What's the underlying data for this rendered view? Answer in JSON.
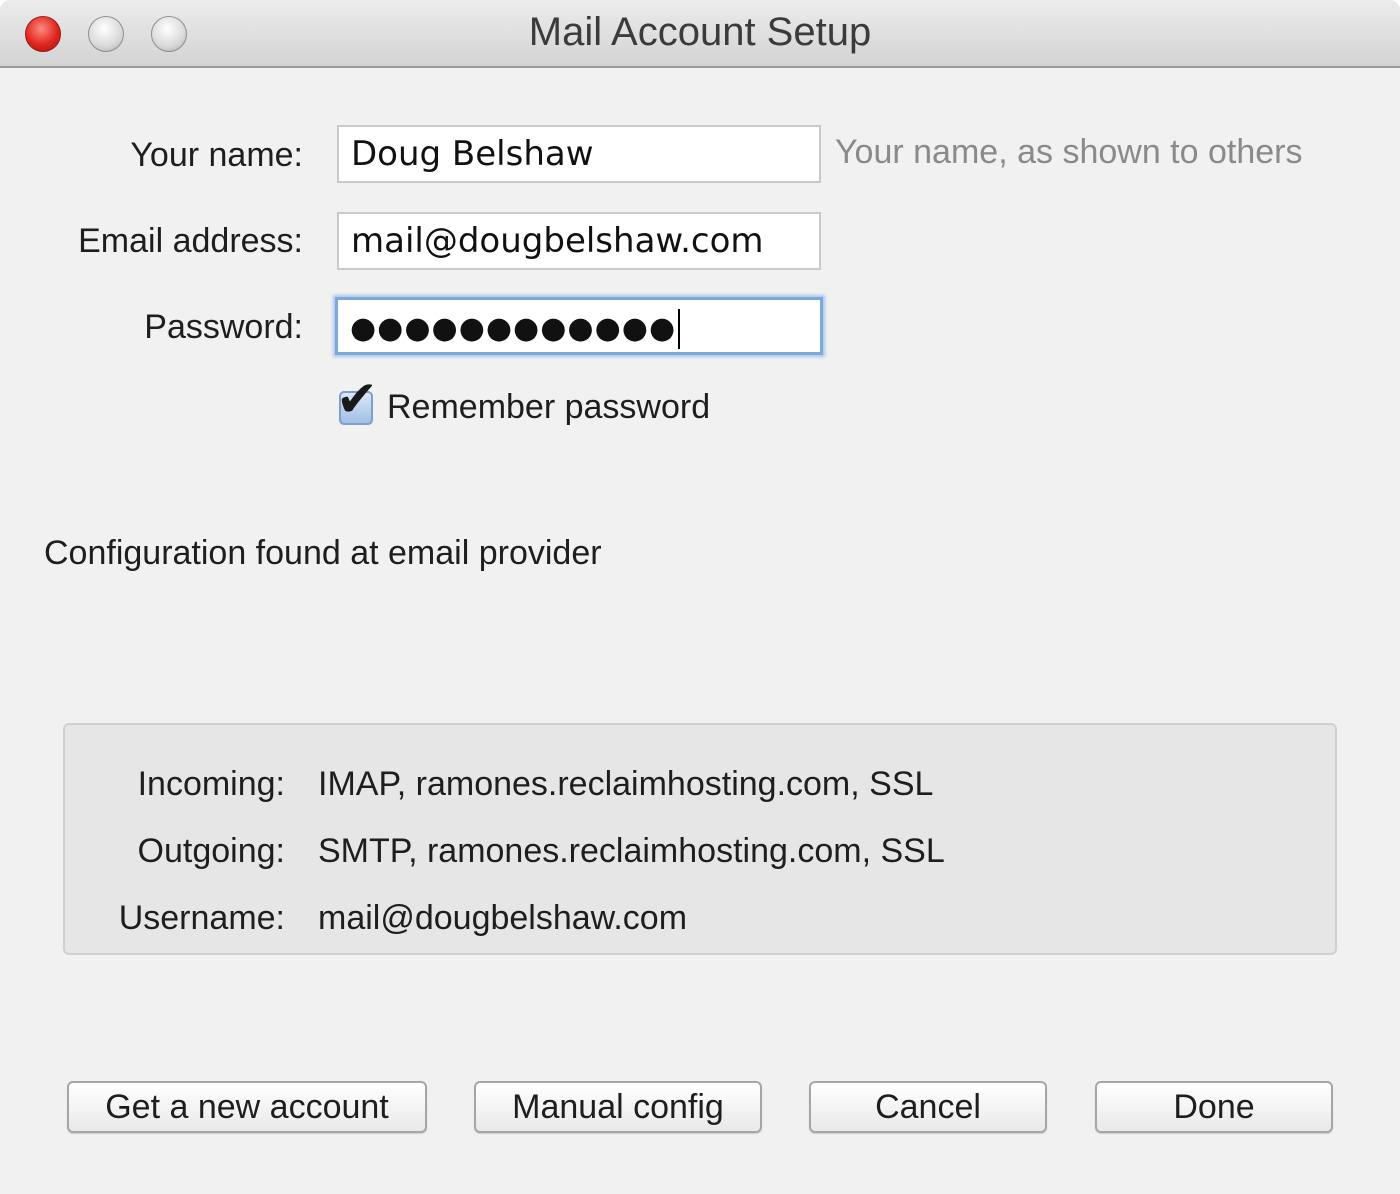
{
  "window": {
    "title": "Mail Account Setup"
  },
  "form": {
    "name_label": "Your name:",
    "name_value": "Doug Belshaw",
    "name_hint": "Your name, as shown to others",
    "email_label": "Email address:",
    "email_value": "mail@dougbelshaw.com",
    "password_label": "Password:",
    "password_value": "●●●●●●●●●●●●",
    "remember_label": "Remember password",
    "remember_checked": true
  },
  "status": {
    "message": "Configuration found at email provider"
  },
  "config": {
    "incoming_label": "Incoming:",
    "incoming_value": "IMAP, ramones.reclaimhosting.com, SSL",
    "outgoing_label": "Outgoing:",
    "outgoing_value": "SMTP, ramones.reclaimhosting.com, SSL",
    "username_label": "Username:",
    "username_value": "mail@dougbelshaw.com"
  },
  "buttons": {
    "new_account": "Get a new account",
    "manual_config": "Manual config",
    "cancel": "Cancel",
    "done": "Done"
  }
}
